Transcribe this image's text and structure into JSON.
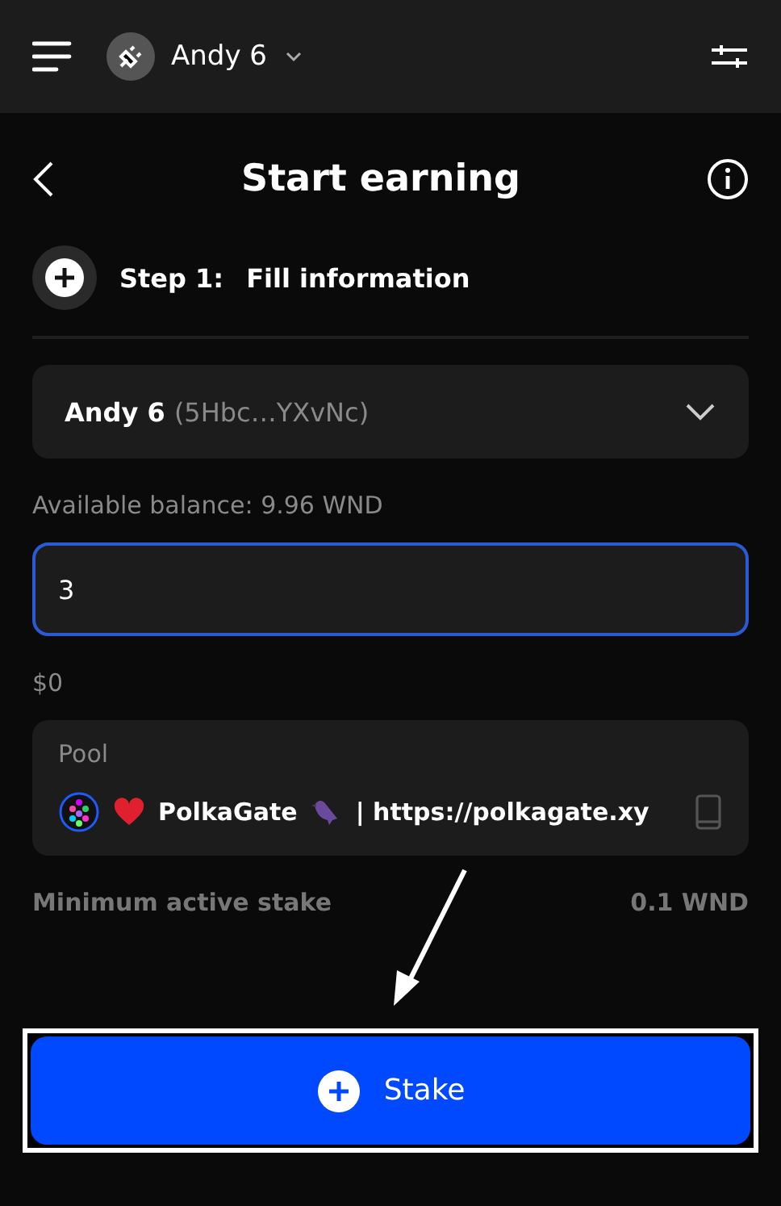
{
  "header": {
    "account": "Andy 6"
  },
  "page": {
    "title": "Start earning"
  },
  "step": {
    "label": "Step 1:",
    "title": "Fill information"
  },
  "account_select": {
    "name": "Andy 6",
    "address": "(5Hbc…YXvNc)"
  },
  "balance": {
    "label": "Available balance:",
    "value": "9.96 WND"
  },
  "amount": {
    "value": "3"
  },
  "fiat": "$0",
  "pool": {
    "label": "Pool",
    "name": "PolkaGate",
    "link": "| https://polkagate.xy"
  },
  "info_rows": [
    {
      "label": "Minimum active stake",
      "value": "0.1 WND"
    }
  ],
  "stake_button": "Stake"
}
